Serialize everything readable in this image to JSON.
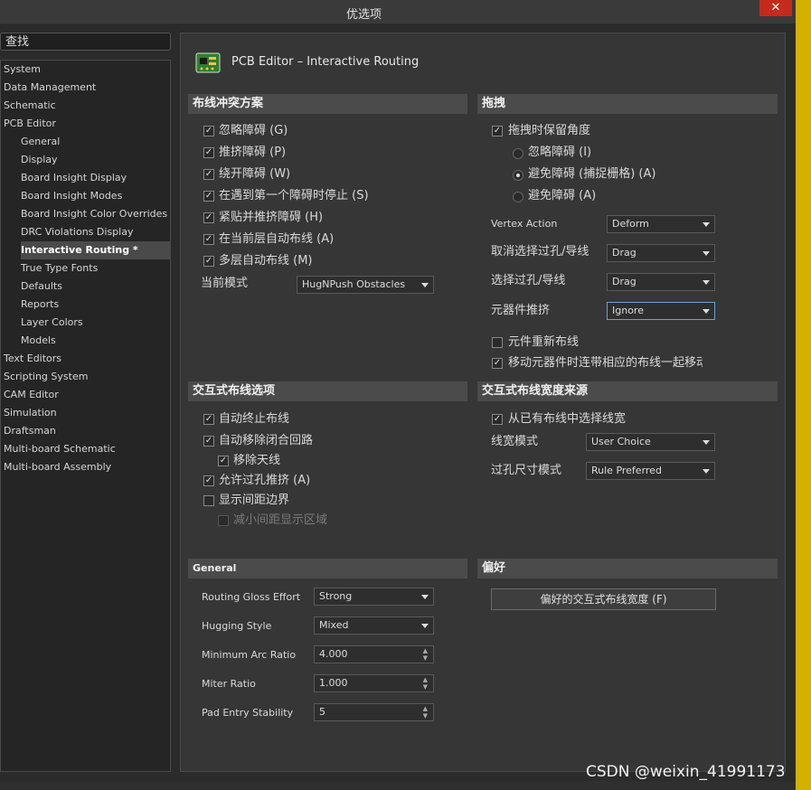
{
  "window": {
    "title": "优选项",
    "close": "✕"
  },
  "search": {
    "label": "查找"
  },
  "tree": [
    {
      "label": "System",
      "level": 0
    },
    {
      "label": "Data Management",
      "level": 0
    },
    {
      "label": "Schematic",
      "level": 0
    },
    {
      "label": "PCB Editor",
      "level": 0
    },
    {
      "label": "General",
      "level": 1
    },
    {
      "label": "Display",
      "level": 1
    },
    {
      "label": "Board Insight Display",
      "level": 1
    },
    {
      "label": "Board Insight Modes",
      "level": 1
    },
    {
      "label": "Board Insight Color Overrides",
      "level": 1
    },
    {
      "label": "DRC Violations Display",
      "level": 1
    },
    {
      "label": "Interactive Routing *",
      "level": 1,
      "selected": true
    },
    {
      "label": "True Type Fonts",
      "level": 1
    },
    {
      "label": "Defaults",
      "level": 1
    },
    {
      "label": "Reports",
      "level": 1
    },
    {
      "label": "Layer Colors",
      "level": 1
    },
    {
      "label": "Models",
      "level": 1
    },
    {
      "label": "Text Editors",
      "level": 0
    },
    {
      "label": "Scripting System",
      "level": 0
    },
    {
      "label": "CAM Editor",
      "level": 0
    },
    {
      "label": "Simulation",
      "level": 0
    },
    {
      "label": "Draftsman",
      "level": 0
    },
    {
      "label": "Multi-board Schematic",
      "level": 0
    },
    {
      "label": "Multi-board Assembly",
      "level": 0
    }
  ],
  "page": {
    "title": "PCB Editor – Interactive Routing",
    "icon": "pcb-board-icon"
  },
  "conflict": {
    "header": "布线冲突方案",
    "options": [
      {
        "label": "忽略障碍 (G)",
        "checked": true
      },
      {
        "label": "推挤障碍 (P)",
        "checked": true
      },
      {
        "label": "绕开障碍 (W)",
        "checked": true
      },
      {
        "label": "在遇到第一个障碍时停止 (S)",
        "checked": true
      },
      {
        "label": "紧贴并推挤障碍 (H)",
        "checked": true
      },
      {
        "label": "在当前层自动布线 (A)",
        "checked": true
      },
      {
        "label": "多层自动布线 (M)",
        "checked": true
      }
    ],
    "mode_label": "当前模式",
    "mode_value": "HugNPush Obstacles"
  },
  "drag": {
    "header": "拖拽",
    "preserve_label": "拖拽时保留角度",
    "radios": [
      {
        "label": "忽略障碍 (I)",
        "selected": false
      },
      {
        "label": "避免障碍 (捕捉栅格) (A)",
        "selected": true
      },
      {
        "label": "避免障碍 (A)",
        "selected": false
      }
    ],
    "vertex_label": "Vertex Action",
    "vertex_value": "Deform",
    "unselect_label": "取消选择过孔/导线",
    "unselect_value": "Drag",
    "select_label": "选择过孔/导线",
    "select_value": "Drag",
    "comp_push_label": "元器件推挤",
    "comp_push_value": "Ignore",
    "reroute_label": "元件重新布线",
    "move_label": "移动元器件时连带相应的布线一起移动"
  },
  "interactive": {
    "header": "交互式布线选项",
    "auto_term": "自动终止布线",
    "auto_remove": "自动移除闭合回路",
    "remove_antenna": "移除天线",
    "allow_via": "允许过孔推挤 (A)",
    "show_clear": "显示间距边界",
    "reduce_clear": "减小间距显示区域"
  },
  "width_source": {
    "header": "交互式布线宽度来源",
    "pick_label": "从已有布线中选择线宽",
    "width_mode_label": "线宽模式",
    "width_mode_value": "User Choice",
    "via_mode_label": "过孔尺寸模式",
    "via_mode_value": "Rule Preferred"
  },
  "general": {
    "header": "General",
    "gloss_label": "Routing Gloss Effort",
    "gloss_value": "Strong",
    "hug_label": "Hugging Style",
    "hug_value": "Mixed",
    "arc_label": "Minimum Arc Ratio",
    "arc_value": "4.000",
    "miter_label": "Miter Ratio",
    "miter_value": "1.000",
    "pad_label": "Pad Entry Stability",
    "pad_value": "5"
  },
  "favorites": {
    "header": "偏好",
    "button": "偏好的交互式布线宽度 (F)"
  },
  "watermark": "CSDN @weixin_41991173",
  "colors": {
    "accent_close": "#c42b1c",
    "selection": "#4a4a4a",
    "section_header": "#4b4b4b",
    "focus_border": "#6aa0d8"
  }
}
